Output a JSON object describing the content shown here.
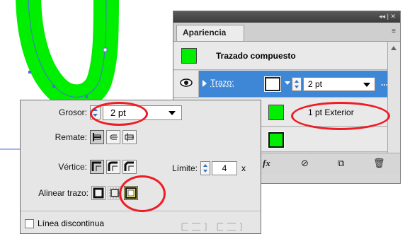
{
  "appearance_panel": {
    "tab_label": "Apariencia",
    "titlebar_controls": "◂◂ | ✕",
    "menu_icon": "≡",
    "compound_path_label": "Trazado compuesto",
    "stroke_row": {
      "label": "Trazo:",
      "weight_value": "2 pt",
      "more_label": "..."
    },
    "stroke_detail_label": "1 pt  Exterior",
    "bottom_icons": [
      "fx",
      "⊘",
      "⧉",
      "🗑"
    ],
    "colors": {
      "fill": "#00ee00",
      "selection": "#3e86d6"
    }
  },
  "stroke_popup": {
    "weight_label": "Grosor:",
    "weight_value": "2 pt",
    "cap_label": "Remate:",
    "corner_label": "Vértice:",
    "miter_label": "Límite:",
    "miter_value": "4",
    "miter_unit": "x",
    "align_label": "Alinear trazo:",
    "dashed_label": "Línea discontinua",
    "dashed_checked": false
  },
  "annotation_color": "#ee1c24"
}
